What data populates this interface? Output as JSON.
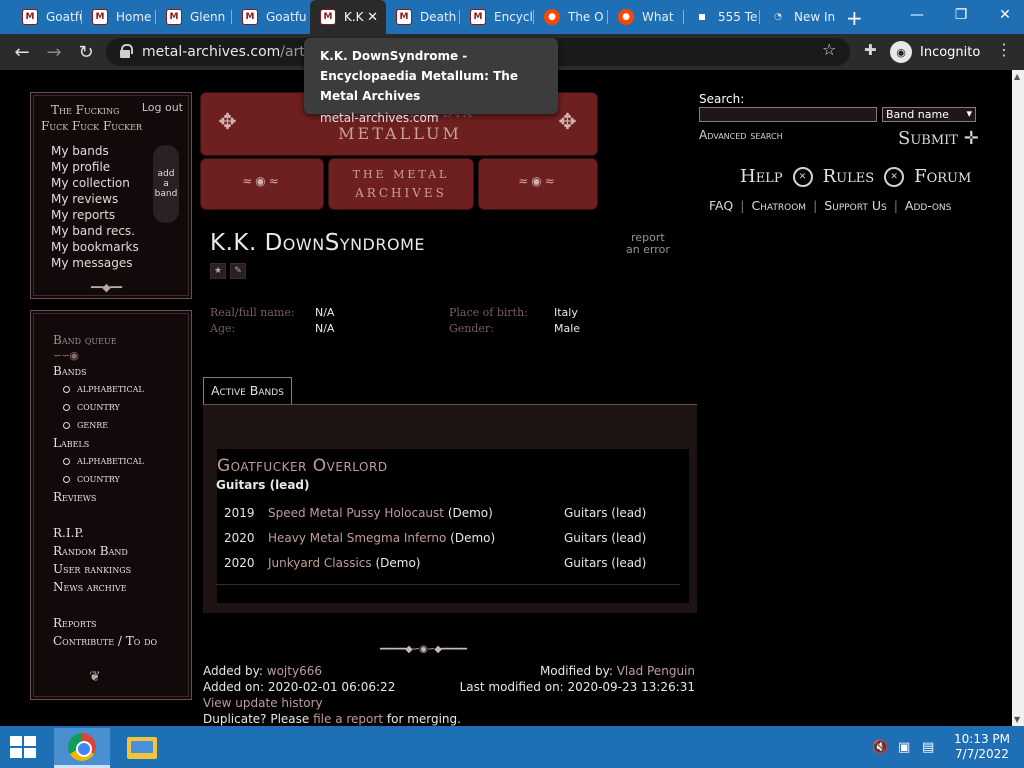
{
  "browser": {
    "tabs": [
      {
        "label": "Goatfu",
        "favicon": "metal-archives-favicon"
      },
      {
        "label": "Home",
        "favicon": "metal-archives-favicon"
      },
      {
        "label": "Glenn",
        "favicon": "metal-archives-favicon"
      },
      {
        "label": "Goatfu",
        "favicon": "metal-archives-favicon"
      },
      {
        "label": "K.K",
        "favicon": "metal-archives-favicon",
        "active": true
      },
      {
        "label": "Death",
        "favicon": "metal-archives-favicon"
      },
      {
        "label": "Encycl",
        "favicon": "metal-archives-favicon"
      },
      {
        "label": "The O",
        "favicon": "reddit-favicon"
      },
      {
        "label": "What",
        "favicon": "reddit-favicon"
      },
      {
        "label": "555 Te",
        "favicon": "grid-favicon"
      },
      {
        "label": "New In",
        "favicon": "new-tab-favicon"
      }
    ],
    "url_domain": "metal-archives.com",
    "url_path": "/artists",
    "profile_label": "Incognito",
    "tooltip": {
      "title": "K.K. DownSyndrome - Encyclopaedia Metallum: The Metal Archives",
      "domain": "metal-archives.com"
    }
  },
  "user_box": {
    "username_line1": "The Fucking",
    "username_line2": "Fuck Fuck Fucker",
    "logout": "Log out",
    "menu": [
      "My bands",
      "My profile",
      "My collection",
      "My reviews",
      "My reports",
      "My band recs.",
      "My bookmarks",
      "My messages"
    ],
    "add_band": [
      "add",
      "a",
      "band"
    ]
  },
  "side_nav": {
    "band_queue": "Band queue",
    "bands": "Bands",
    "bands_sub": [
      "alphabetical",
      "country",
      "genre"
    ],
    "labels": "Labels",
    "labels_sub": [
      "alphabetical",
      "country"
    ],
    "reviews": "Reviews",
    "rip": "R.I.P.",
    "random_band": "Random Band",
    "user_rankings": "User rankings",
    "news_archive": "News archive",
    "reports": "Reports",
    "contribute": "Contribute / To do"
  },
  "logo": {
    "line1": "ENCYCLOPAEDIA",
    "line2": "METALLUM",
    "line3": "THE METAL",
    "line4": "ARCHIVES"
  },
  "search": {
    "label": "Search:",
    "value": "",
    "type_selected": "Band name",
    "advanced": "Advanced search",
    "submit": "Submit"
  },
  "top_nav": [
    "Help",
    "Rules",
    "Forum"
  ],
  "sub_nav": [
    "FAQ",
    "Chatroom",
    "Support Us",
    "Add-ons"
  ],
  "artist": {
    "name": "K.K. DownSyndrome",
    "report_line1": "report",
    "report_line2": "an error",
    "details": {
      "real_name_label": "Real/full name:",
      "real_name": "N/A",
      "age_label": "Age:",
      "age": "N/A",
      "birth_label": "Place of birth:",
      "birth": "Italy",
      "gender_label": "Gender:",
      "gender": "Male"
    }
  },
  "active_bands_tab": "Active Bands",
  "band": {
    "name": "Goatfucker Overlord",
    "role": "Guitars (lead)",
    "releases": [
      {
        "year": "2019",
        "title": "Speed Metal Pussy Holocaust",
        "type": "(Demo)",
        "role": "Guitars (lead)"
      },
      {
        "year": "2020",
        "title": "Heavy Metal Smegma Inferno",
        "type": "(Demo)",
        "role": "Guitars (lead)"
      },
      {
        "year": "2020",
        "title": "Junkyard Classics",
        "type": "(Demo)",
        "role": "Guitars (lead)"
      }
    ]
  },
  "audit": {
    "added_by_label": "Added by:",
    "added_by": "wojty666",
    "added_on_label": "Added on:",
    "added_on": "2020-02-01 06:06:22",
    "modified_by_label": "Modified by:",
    "modified_by": "Vlad Penguin",
    "last_modified_label": "Last modified on:",
    "last_modified": "2020-09-23 13:26:31",
    "history_link": "View update history",
    "dup_prefix": "Duplicate? Please",
    "dup_link": "file a report",
    "dup_suffix": "for merging."
  },
  "taskbar": {
    "time": "10:13 PM",
    "date": "7/7/2022"
  }
}
